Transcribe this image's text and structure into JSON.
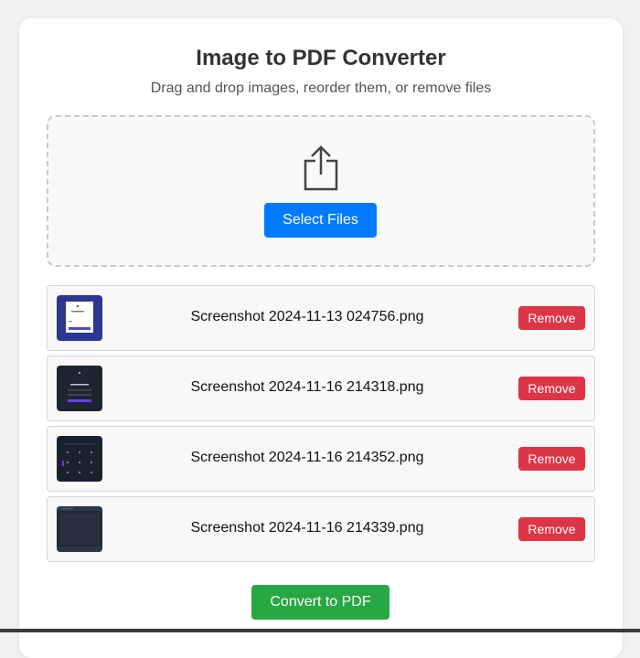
{
  "header": {
    "title": "Image to PDF Converter",
    "subtitle": "Drag and drop images, reorder them, or remove files"
  },
  "dropzone": {
    "icon": "upload-share-icon",
    "select_label": "Select Files"
  },
  "files": [
    {
      "name": "Screenshot 2024-11-13 024756.png",
      "remove_label": "Remove"
    },
    {
      "name": "Screenshot 2024-11-16 214318.png",
      "remove_label": "Remove"
    },
    {
      "name": "Screenshot 2024-11-16 214352.png",
      "remove_label": "Remove"
    },
    {
      "name": "Screenshot 2024-11-16 214339.png",
      "remove_label": "Remove"
    }
  ],
  "actions": {
    "convert_label": "Convert to PDF"
  },
  "colors": {
    "primary": "#007bff",
    "danger": "#dc3545",
    "success": "#28a745"
  }
}
